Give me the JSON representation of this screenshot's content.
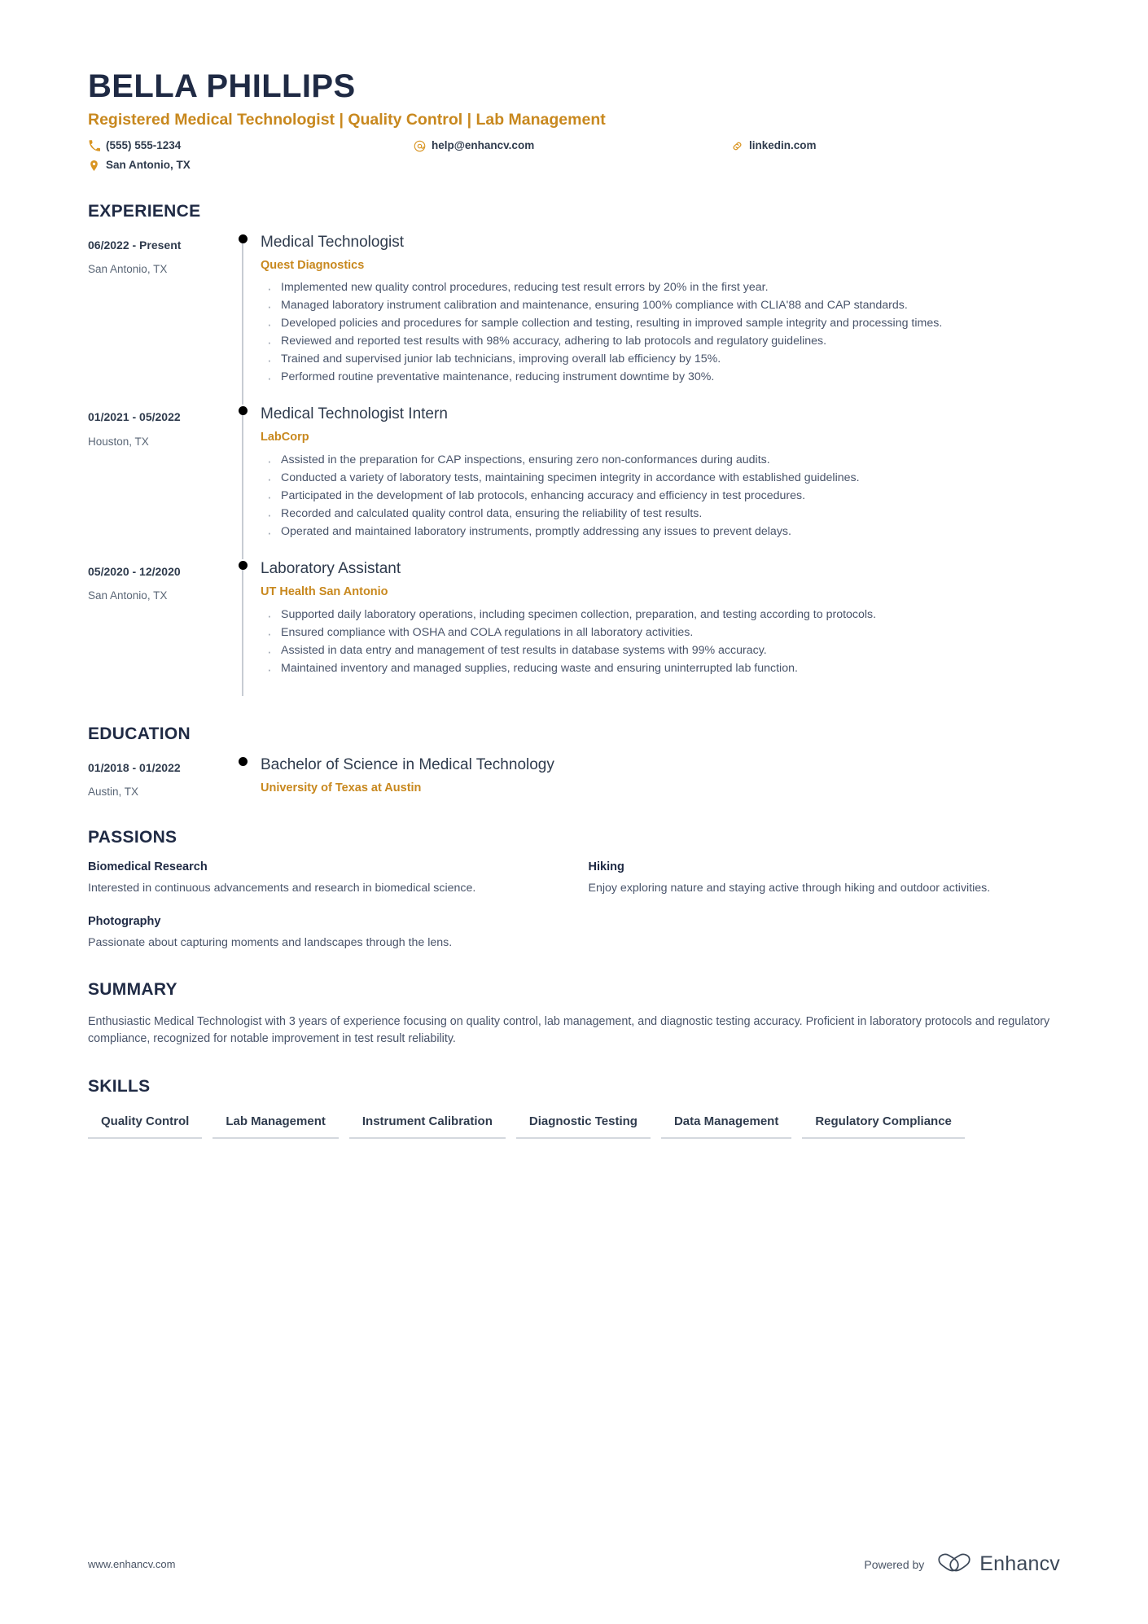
{
  "header": {
    "full_name": "BELLA PHILLIPS",
    "headline": "Registered Medical Technologist | Quality Control | Lab Management",
    "contacts": [
      {
        "icon": "phone-icon",
        "text": "(555) 555-1234"
      },
      {
        "icon": "email-icon",
        "text": "help@enhancv.com"
      },
      {
        "icon": "link-icon",
        "text": "linkedin.com"
      },
      {
        "icon": "location-icon",
        "text": "San Antonio, TX"
      }
    ]
  },
  "sections": {
    "experience": {
      "title": "EXPERIENCE",
      "entries": [
        {
          "date": "06/2022 - Present",
          "location": "San Antonio, TX",
          "title": "Medical Technologist",
          "organization": "Quest Diagnostics",
          "bullets": [
            "Implemented new quality control procedures, reducing test result errors by 20% in the first year.",
            "Managed laboratory instrument calibration and maintenance, ensuring 100% compliance with CLIA'88 and CAP standards.",
            "Developed policies and procedures for sample collection and testing, resulting in improved sample integrity and processing times.",
            "Reviewed and reported test results with 98% accuracy, adhering to lab protocols and regulatory guidelines.",
            "Trained and supervised junior lab technicians, improving overall lab efficiency by 15%.",
            "Performed routine preventative maintenance, reducing instrument downtime by 30%."
          ]
        },
        {
          "date": "01/2021 - 05/2022",
          "location": "Houston, TX",
          "title": "Medical Technologist Intern",
          "organization": "LabCorp",
          "bullets": [
            "Assisted in the preparation for CAP inspections, ensuring zero non-conformances during audits.",
            "Conducted a variety of laboratory tests, maintaining specimen integrity in accordance with established guidelines.",
            "Participated in the development of lab protocols, enhancing accuracy and efficiency in test procedures.",
            "Recorded and calculated quality control data, ensuring the reliability of test results.",
            "Operated and maintained laboratory instruments, promptly addressing any issues to prevent delays."
          ]
        },
        {
          "date": "05/2020 - 12/2020",
          "location": "San Antonio, TX",
          "title": "Laboratory Assistant",
          "organization": "UT Health San Antonio",
          "bullets": [
            "Supported daily laboratory operations, including specimen collection, preparation, and testing according to protocols.",
            "Ensured compliance with OSHA and COLA regulations in all laboratory activities.",
            "Assisted in data entry and management of test results in database systems with 99% accuracy.",
            "Maintained inventory and managed supplies, reducing waste and ensuring uninterrupted lab function."
          ]
        }
      ]
    },
    "education": {
      "title": "EDUCATION",
      "entries": [
        {
          "date": "01/2018 - 01/2022",
          "location": "Austin, TX",
          "title": "Bachelor of Science in Medical Technology",
          "organization": "University of Texas at Austin"
        }
      ]
    },
    "passions": {
      "title": "PASSIONS",
      "items": [
        {
          "name": "Biomedical Research",
          "description": "Interested in continuous advancements and research in biomedical science."
        },
        {
          "name": "Hiking",
          "description": "Enjoy exploring nature and staying active through hiking and outdoor activities."
        },
        {
          "name": "Photography",
          "description": "Passionate about capturing moments and landscapes through the lens."
        }
      ]
    },
    "summary": {
      "title": "SUMMARY",
      "text": "Enthusiastic Medical Technologist with 3 years of experience focusing on quality control, lab management, and diagnostic testing accuracy. Proficient in laboratory protocols and regulatory compliance, recognized for notable improvement in test result reliability."
    },
    "skills": {
      "title": "SKILLS",
      "items": [
        "Quality Control",
        "Lab Management",
        "Instrument Calibration",
        "Diagnostic Testing",
        "Data Management",
        "Regulatory Compliance"
      ]
    }
  },
  "footer": {
    "url": "www.enhancv.com",
    "powered_by_label": "Powered by",
    "brand_name": "Enhancv"
  },
  "colors": {
    "accent_orange": "#c8881e",
    "heading_navy": "#1f2a44",
    "body_text": "#49546a",
    "rail_gray": "#c7ccd3"
  }
}
